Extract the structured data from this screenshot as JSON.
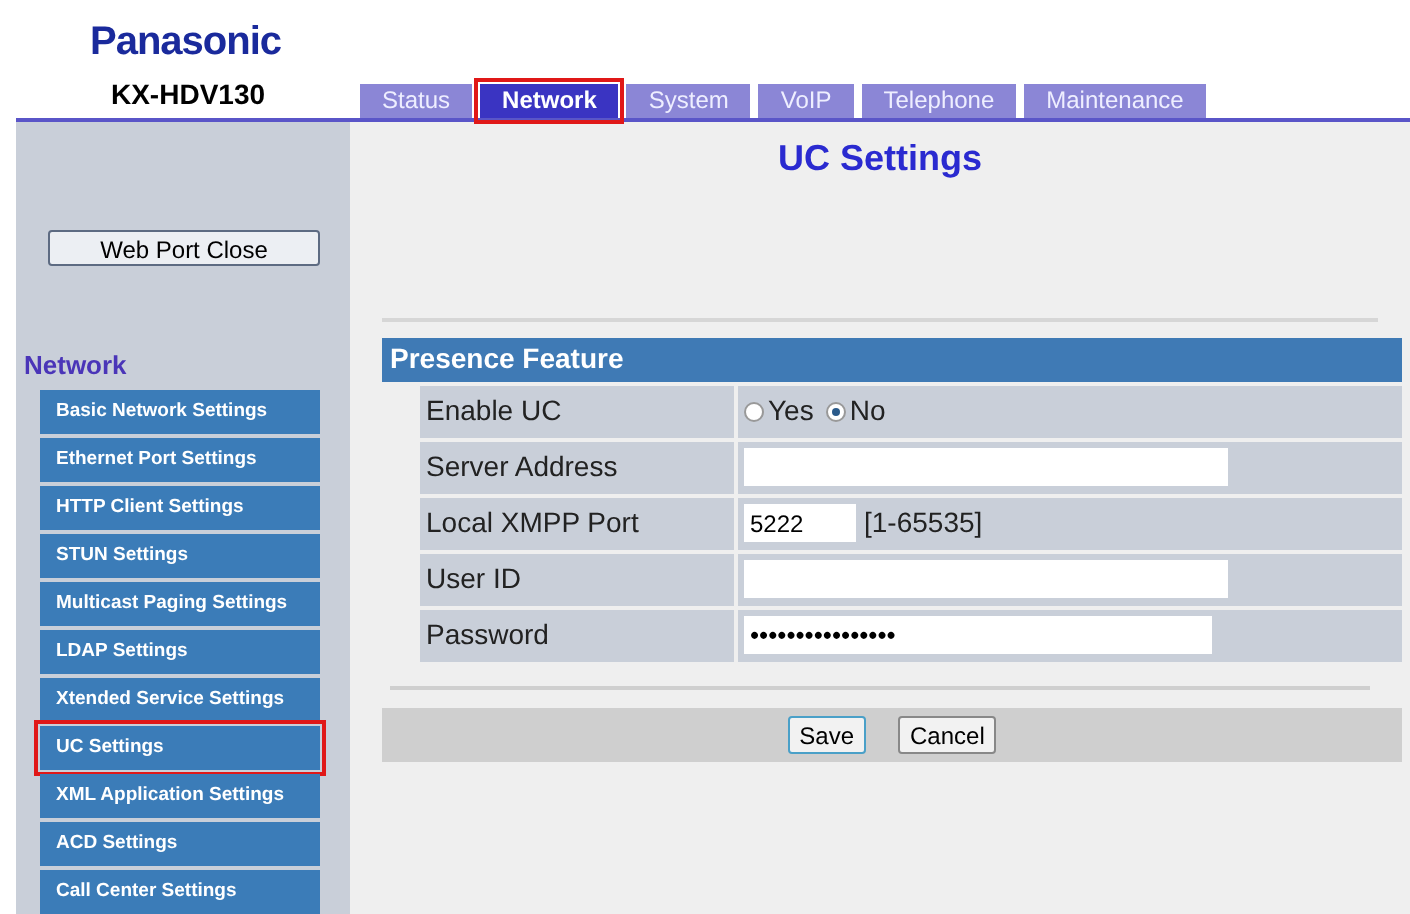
{
  "brand": "Panasonic",
  "model": "KX-HDV130",
  "tabs": [
    {
      "label": "Status",
      "selected": false,
      "highlighted": false
    },
    {
      "label": "Network",
      "selected": true,
      "highlighted": true
    },
    {
      "label": "System",
      "selected": false,
      "highlighted": false
    },
    {
      "label": "VoIP",
      "selected": false,
      "highlighted": false
    },
    {
      "label": "Telephone",
      "selected": false,
      "highlighted": false
    },
    {
      "label": "Maintenance",
      "selected": false,
      "highlighted": false
    }
  ],
  "page_title": "UC Settings",
  "web_port_button": "Web Port Close",
  "sidebar": {
    "heading": "Network",
    "items": [
      {
        "label": "Basic Network Settings",
        "highlighted": false
      },
      {
        "label": "Ethernet Port Settings",
        "highlighted": false
      },
      {
        "label": "HTTP Client Settings",
        "highlighted": false
      },
      {
        "label": "STUN Settings",
        "highlighted": false
      },
      {
        "label": "Multicast Paging Settings",
        "highlighted": false
      },
      {
        "label": "LDAP Settings",
        "highlighted": false
      },
      {
        "label": "Xtended Service Settings",
        "highlighted": false
      },
      {
        "label": "UC Settings",
        "highlighted": true
      },
      {
        "label": "XML Application Settings",
        "highlighted": false
      },
      {
        "label": "ACD Settings",
        "highlighted": false
      },
      {
        "label": "Call Center Settings",
        "highlighted": false
      }
    ]
  },
  "section": {
    "title": "Presence Feature",
    "rows": [
      {
        "kind": "radio",
        "label": "Enable UC",
        "options": [
          {
            "label": "Yes",
            "selected": false
          },
          {
            "label": "No",
            "selected": true
          }
        ]
      },
      {
        "kind": "text",
        "label": "Server Address",
        "value": ""
      },
      {
        "kind": "port",
        "label": "Local XMPP Port",
        "value": "5222",
        "range": "[1-65535]"
      },
      {
        "kind": "text",
        "label": "User ID",
        "value": ""
      },
      {
        "kind": "password",
        "label": "Password",
        "value": "••••••••••••••••"
      }
    ]
  },
  "buttons": [
    "Save",
    "Cancel"
  ]
}
